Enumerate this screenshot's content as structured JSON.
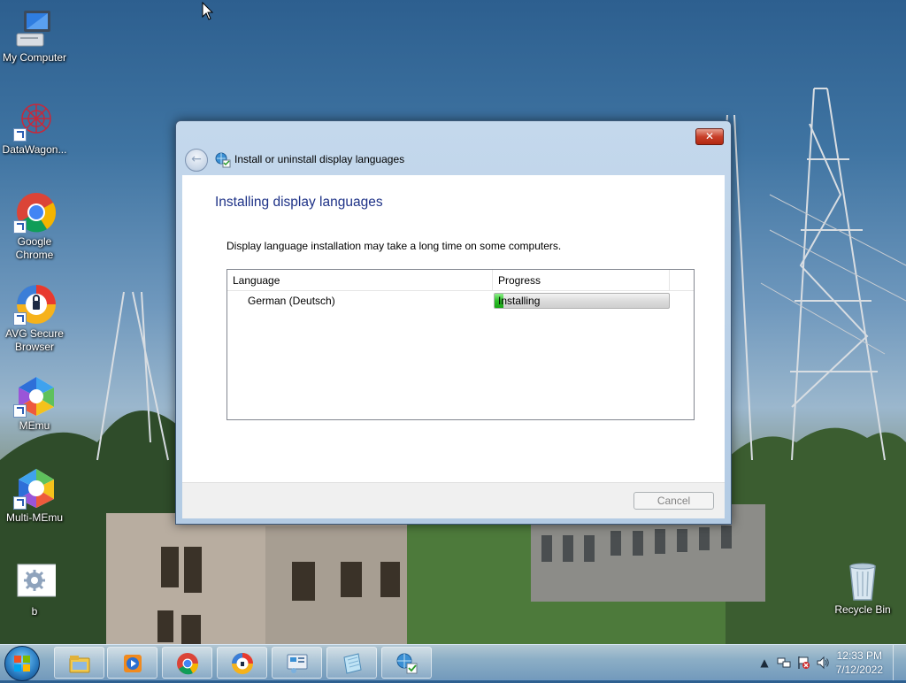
{
  "desktop": {
    "icons": [
      {
        "label": "My Computer",
        "icon": "computer-icon"
      },
      {
        "label": "DataWagon...",
        "icon": "datawagon-icon"
      },
      {
        "label": "Google Chrome",
        "icon": "chrome-icon"
      },
      {
        "label": "AVG Secure Browser",
        "icon": "avg-browser-icon"
      },
      {
        "label": "MEmu",
        "icon": "memu-icon"
      },
      {
        "label": "Multi-MEmu",
        "icon": "multi-memu-icon"
      },
      {
        "label": "b",
        "icon": "settings-file-icon"
      },
      {
        "label": "Recycle Bin",
        "icon": "recycle-bin-icon"
      }
    ]
  },
  "dialog": {
    "title": "Install or uninstall display languages",
    "close_glyph": "✕",
    "heading": "Installing display languages",
    "info": "Display language installation may take a long time on some computers.",
    "columns": {
      "language": "Language",
      "progress": "Progress"
    },
    "rows": [
      {
        "language": "German (Deutsch)",
        "status": "Installing",
        "progress_fraction": 0.05
      }
    ],
    "cancel_label": "Cancel",
    "colors": {
      "heading": "#1e3287",
      "progress": "#2fbf2a"
    }
  },
  "taskbar": {
    "buttons": [
      "windows-explorer-icon",
      "media-player-icon",
      "chrome-icon",
      "avg-browser-icon",
      "control-panel-icon",
      "notepad-icon",
      "language-setup-icon"
    ],
    "clock": {
      "time": "12:33 PM",
      "date": "7/12/2022"
    }
  }
}
